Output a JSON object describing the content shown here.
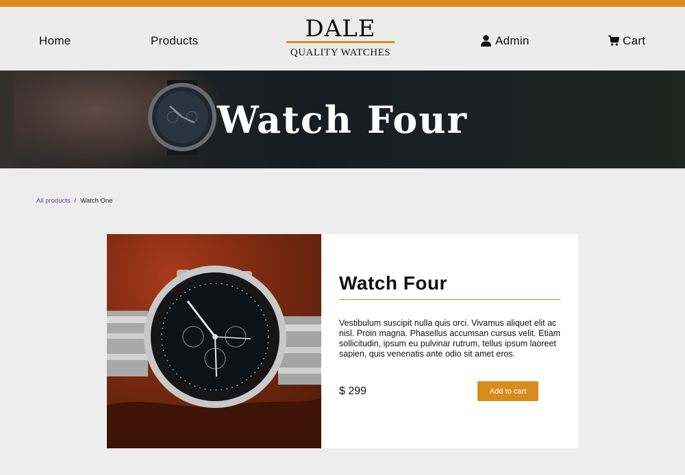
{
  "nav": {
    "home": "Home",
    "products": "Products",
    "admin": "Admin",
    "cart": "Cart"
  },
  "brand": {
    "name": "DALE",
    "tagline": "QUALITY WATCHES"
  },
  "hero": {
    "title": "Watch Four"
  },
  "breadcrumb": {
    "parent": "All products",
    "separator": "/",
    "current": "Watch One"
  },
  "product": {
    "title": "Watch Four",
    "description": "Vestibulum suscipit nulla quis orci. Vivamus aliquet elit ac nisl. Proin magna. Phasellus accumsan cursus velit. Etiam sollicitudin, ipsum eu pulvinar rutrum, tellus ipsum laoreet sapien, quis venenatis ante odio sit amet eros.",
    "price": "$ 299",
    "add_to_cart": "Add to cart"
  },
  "colors": {
    "accent": "#d98c1e",
    "background": "#ededed",
    "link": "#6a3fa0"
  },
  "icons": {
    "admin": "user-icon",
    "cart": "shopping-cart-icon"
  }
}
